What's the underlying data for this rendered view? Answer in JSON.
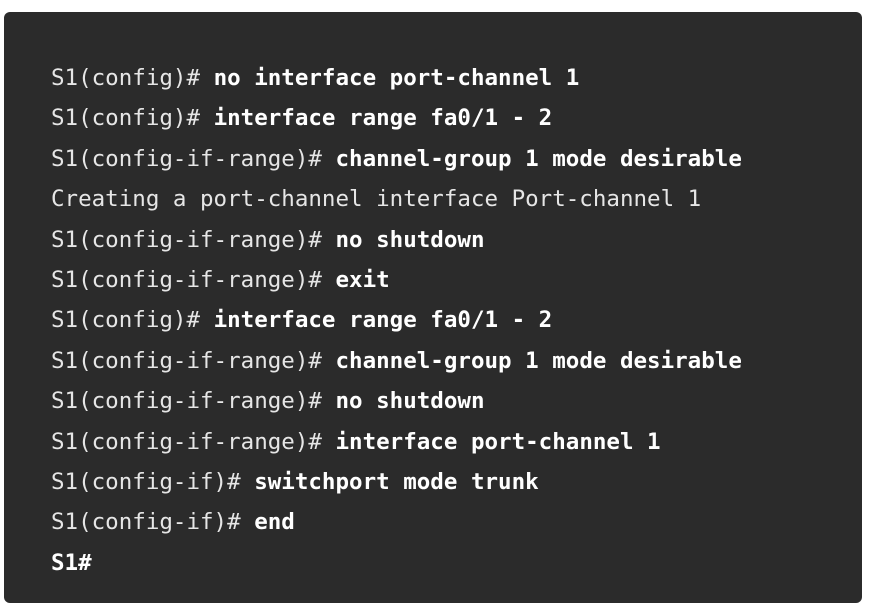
{
  "terminal": {
    "lines": [
      {
        "prompt": "S1(config)# ",
        "command": "no interface port-channel 1"
      },
      {
        "prompt": "S1(config)# ",
        "command": "interface range fa0/1 - 2"
      },
      {
        "prompt": "S1(config-if-range)# ",
        "command": "channel-group 1 mode desirable"
      },
      {
        "output": "Creating a port-channel interface Port-channel 1"
      },
      {
        "prompt": "S1(config-if-range)# ",
        "command": "no shutdown"
      },
      {
        "prompt": "S1(config-if-range)# ",
        "command": "exit"
      },
      {
        "prompt": "S1(config)# ",
        "command": "interface range fa0/1 - 2"
      },
      {
        "prompt": "S1(config-if-range)# ",
        "command": "channel-group 1 mode desirable"
      },
      {
        "prompt": "S1(config-if-range)# ",
        "command": "no shutdown"
      },
      {
        "prompt": "S1(config-if-range)# ",
        "command": "interface port-channel 1"
      },
      {
        "prompt": "S1(config-if)# ",
        "command": "switchport mode trunk"
      },
      {
        "prompt": "S1(config-if)# ",
        "command": "end"
      },
      {
        "prompt": "S1#",
        "command": ""
      }
    ]
  },
  "colors": {
    "terminal_background": "#2b2b2b",
    "text": "#f2f2f2"
  }
}
